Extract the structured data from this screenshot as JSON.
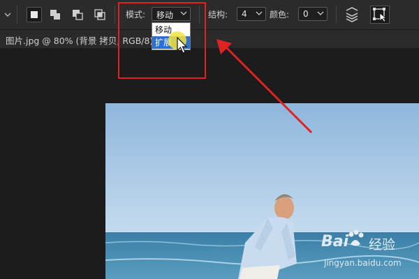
{
  "toolbar": {
    "mode_label": "模式:",
    "mode_value": "移动",
    "structure_label": "结构:",
    "structure_value": "4",
    "color_label": "颜色:",
    "color_value": "0"
  },
  "dropdown": {
    "options": [
      "移动",
      "扩展"
    ],
    "selected_index": 1
  },
  "document": {
    "tab_title": "图片.jpg @ 80% (背景 拷贝, RGB/8)"
  },
  "watermark": {
    "brand": "Bai",
    "brand_tail": "经验",
    "url": "jingyan.baidu.com"
  },
  "colors": {
    "annotation_red": "#e02222",
    "selection_blue": "#2f6fcf",
    "toolbar_bg": "#2b2b2b"
  }
}
